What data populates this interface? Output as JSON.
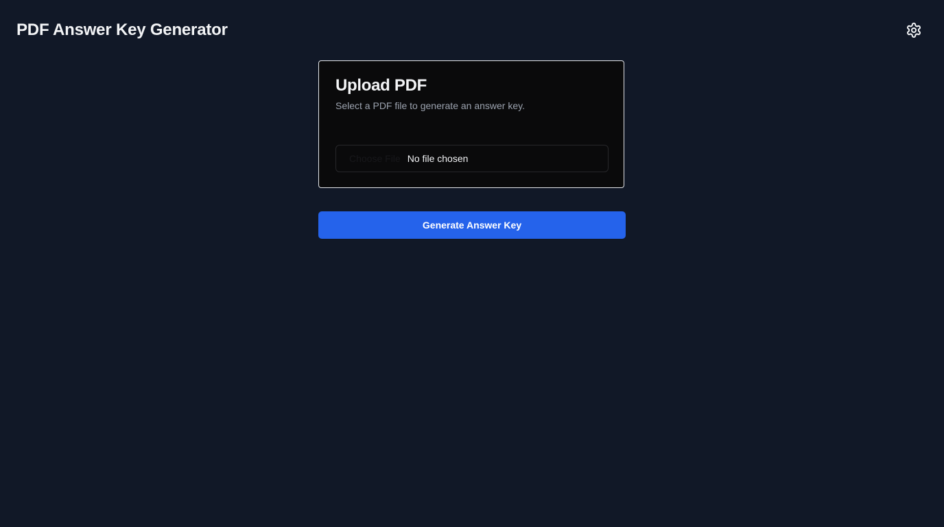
{
  "header": {
    "title": "PDF Answer Key Generator",
    "settings_icon": "gear-icon"
  },
  "upload_card": {
    "title": "Upload PDF",
    "description": "Select a PDF file to generate an answer key.",
    "file_input": {
      "choose_label": "Choose File",
      "status_text": "No file chosen"
    }
  },
  "actions": {
    "generate_label": "Generate Answer Key"
  },
  "colors": {
    "background": "#111827",
    "card_background": "#0a0a0b",
    "card_border": "#e5e7eb",
    "primary_button": "#2563eb",
    "text_primary": "#f3f4f6",
    "text_muted": "#9ca3af"
  }
}
